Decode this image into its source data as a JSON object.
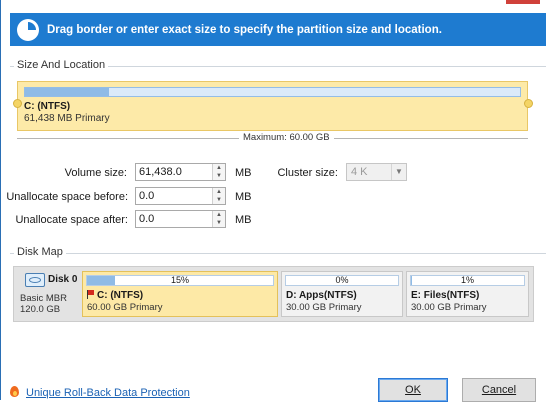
{
  "header": {
    "text": "Drag border or enter exact size to specify the partition size and location.",
    "icon": "pie-chart-icon",
    "color": "#1e7bd0"
  },
  "size_location": {
    "group_label": "Size And Location",
    "partition": {
      "name": "C: (NTFS)",
      "info": "61,438 MB Primary",
      "used_fraction": 0.17
    },
    "maximum_label": "Maximum: 60.00 GB"
  },
  "form": {
    "volume_size": {
      "label": "Volume size:",
      "value": "61,438.0",
      "unit": "MB"
    },
    "unalloc_before": {
      "label": "Unallocate space before:",
      "value": "0.0",
      "unit": "MB"
    },
    "unalloc_after": {
      "label": "Unallocate space after:",
      "value": "0.0",
      "unit": "MB"
    },
    "cluster_size": {
      "label": "Cluster size:",
      "value": "4 K"
    }
  },
  "disk_map": {
    "group_label": "Disk Map",
    "disk": {
      "name": "Disk 0",
      "type": "Basic MBR",
      "size": "120.0 GB"
    },
    "partitions": [
      {
        "pct_label": "15%",
        "fill": 0.15,
        "name": "C: (NTFS)",
        "info": "60.00 GB Primary",
        "selected": true
      },
      {
        "pct_label": "0%",
        "fill": 0.0,
        "name": "D: Apps(NTFS)",
        "info": "30.00 GB Primary",
        "selected": false
      },
      {
        "pct_label": "1%",
        "fill": 0.01,
        "name": "E: Files(NTFS)",
        "info": "30.00 GB Primary",
        "selected": false
      }
    ]
  },
  "footer": {
    "link": "Unique Roll-Back Data Protection",
    "ok": "OK",
    "cancel": "Cancel"
  }
}
